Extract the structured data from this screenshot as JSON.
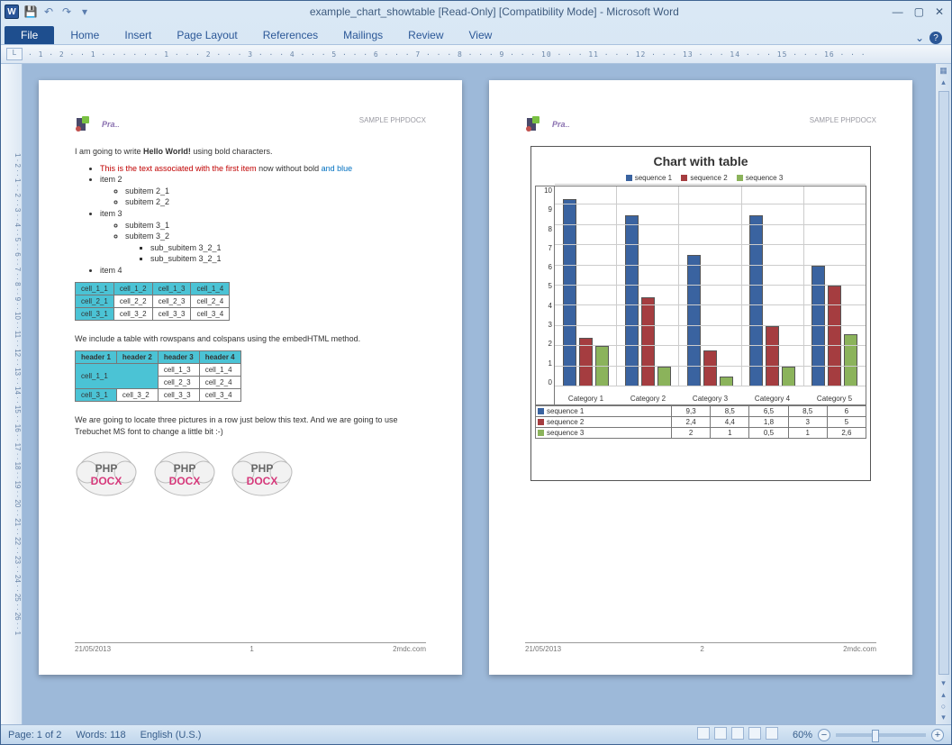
{
  "titlebar": {
    "title": "example_chart_showtable [Read-Only] [Compatibility Mode]  -  Microsoft Word",
    "app_letter": "W"
  },
  "ribbon": {
    "file": "File",
    "tabs": [
      "Home",
      "Insert",
      "Page Layout",
      "References",
      "Mailings",
      "Review",
      "View"
    ]
  },
  "status": {
    "page": "Page: 1 of 2",
    "words": "Words: 118",
    "lang": "English (U.S.)",
    "zoom": "60%"
  },
  "ruler_top": "· 1 · 2 ·  · 1 · · ·  · · · 1 · · · 2 · · · 3 · · · 4 · · · 5 · · · 6 · · · 7 · · · 8 · · · 9 · · · 10 · · · 11 · · · 12 · · · 13 · · · 14 · · · 15 · · · 16 · · ·",
  "ruler_left": "1 · 2 · · 1 · · 2 · · 3 · · 4 · · 5 · · 6 · · 7 · · 8 · · 9 · · 10 · · 11 · · 12 · · 13 · · 14 · · 15 · · 16 · · 17 · · 18 · · 19 · · 20 · · 21 · · 22 · · 23 · · 24 · · 25 · · 26 · · 1",
  "header": {
    "sample": "SAMPLE PHPDOCX"
  },
  "page1": {
    "intro_pre": "I am going to write ",
    "intro_bold": "Hello World!",
    "intro_post": " using bold characters.",
    "li1_red": "This is the text associated with the first item",
    "li1_mid": " now without bold ",
    "li1_blue": "and blue",
    "li2": "item 2",
    "li2a": "subitem 2_1",
    "li2b": "subitem 2_2",
    "li3": "item 3",
    "li3a": "subitem 3_1",
    "li3b": "subitem 3_2",
    "li3b1": "sub_subitem 3_2_1",
    "li3b2": "sub_subitem 3_2_1",
    "li4": "item 4",
    "t1": [
      [
        "cell_1_1",
        "cell_1_2",
        "cell_1_3",
        "cell_1_4"
      ],
      [
        "cell_2_1",
        "cell_2_2",
        "cell_2_3",
        "cell_2_4"
      ],
      [
        "cell_3_1",
        "cell_3_2",
        "cell_3_3",
        "cell_3_4"
      ]
    ],
    "embed_text": "We include a table with rowspans and colspans using the embedHTML method.",
    "t2h": [
      "header 1",
      "header 2",
      "header 3",
      "header 4"
    ],
    "t2": [
      [
        "cell_1_1",
        "",
        "cell_1_3",
        "cell_1_4"
      ],
      [
        "",
        "",
        "cell_2_3",
        "cell_2_4"
      ],
      [
        "cell_3_1",
        "cell_3_2",
        "cell_3_3",
        "cell_3_4"
      ]
    ],
    "pic_text": "We are going to locate three pictures in a row just below this text. And we are going to use Trebuchet MS font to change a little bit :-)",
    "eleph_top": "PHP",
    "eleph_bot": "DOCX"
  },
  "footer": {
    "date": "21/05/2013",
    "pnum1": "1",
    "pnum2": "2",
    "domain": "2mdc.com"
  },
  "chart_data": {
    "type": "bar",
    "title": "Chart with table",
    "legend": [
      "sequence 1",
      "sequence 2",
      "sequence 3"
    ],
    "categories": [
      "Category 1",
      "Category 2",
      "Category 3",
      "Category 4",
      "Category 5"
    ],
    "ylim": [
      0,
      10
    ],
    "yticks": [
      0,
      1,
      2,
      3,
      4,
      5,
      6,
      7,
      8,
      9,
      10
    ],
    "series": [
      {
        "name": "sequence 1",
        "color": "#3a63a0",
        "values": [
          9.3,
          8.5,
          6.5,
          8.5,
          6
        ]
      },
      {
        "name": "sequence 2",
        "color": "#a53d40",
        "values": [
          2.4,
          4.4,
          1.8,
          3,
          5
        ]
      },
      {
        "name": "sequence 3",
        "color": "#8bb35b",
        "values": [
          2,
          1,
          0.5,
          1,
          2.6
        ]
      }
    ],
    "table_fmt": [
      [
        "9,3",
        "8,5",
        "6,5",
        "8,5",
        "6"
      ],
      [
        "2,4",
        "4,4",
        "1,8",
        "3",
        "5"
      ],
      [
        "2",
        "1",
        "0,5",
        "1",
        "2,6"
      ]
    ]
  }
}
